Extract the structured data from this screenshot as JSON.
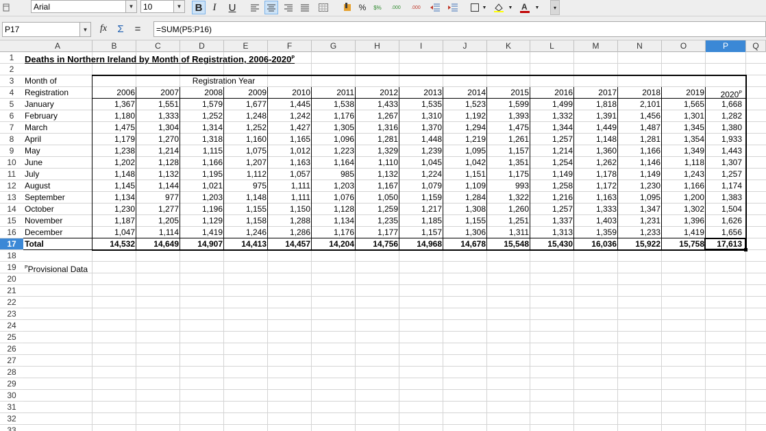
{
  "toolbar": {
    "font_name": "Arial",
    "font_size": "10",
    "bold_label": "B",
    "italic_label": "I",
    "underline_label": "U",
    "percent_label": "%",
    "currency_label": "$%",
    "add_decimal_label": ".000",
    "del_decimal_label": ".000"
  },
  "formula_bar": {
    "cell_ref": "P17",
    "function_wizard_label": "fx",
    "sum_label": "Σ",
    "equals_label": "=",
    "formula": "=SUM(P5:P16)"
  },
  "columns": [
    "A",
    "B",
    "C",
    "D",
    "E",
    "F",
    "G",
    "H",
    "I",
    "J",
    "K",
    "L",
    "M",
    "N",
    "O",
    "P",
    "Q"
  ],
  "selected_column": "P",
  "rows": [
    "1",
    "2",
    "3",
    "4",
    "5",
    "6",
    "7",
    "8",
    "9",
    "10",
    "11",
    "12",
    "13",
    "14",
    "15",
    "16",
    "17",
    "18",
    "19",
    "20",
    "21",
    "22",
    "23",
    "24",
    "25",
    "26",
    "27",
    "28",
    "29",
    "30",
    "31",
    "32",
    "33"
  ],
  "selected_row": "17",
  "sheet": {
    "title": "Deaths in Northern Ireland by Month of Registration, 2006-2020",
    "title_sup": "P",
    "header_month_line1": "Month of",
    "header_month_line2": "Registration",
    "header_year_group": "Registration Year",
    "years": [
      "2006",
      "2007",
      "2008",
      "2009",
      "2010",
      "2011",
      "2012",
      "2013",
      "2014",
      "2015",
      "2016",
      "2017",
      "2018",
      "2019",
      "2020"
    ],
    "last_year_sup": "P",
    "months": [
      {
        "name": "January",
        "values": [
          "1,367",
          "1,551",
          "1,579",
          "1,677",
          "1,445",
          "1,538",
          "1,433",
          "1,535",
          "1,523",
          "1,599",
          "1,499",
          "1,818",
          "2,101",
          "1,565",
          "1,668"
        ]
      },
      {
        "name": "February",
        "values": [
          "1,180",
          "1,333",
          "1,252",
          "1,248",
          "1,242",
          "1,176",
          "1,267",
          "1,310",
          "1,192",
          "1,393",
          "1,332",
          "1,391",
          "1,456",
          "1,301",
          "1,282"
        ]
      },
      {
        "name": "March",
        "values": [
          "1,475",
          "1,304",
          "1,314",
          "1,252",
          "1,427",
          "1,305",
          "1,316",
          "1,370",
          "1,294",
          "1,475",
          "1,344",
          "1,449",
          "1,487",
          "1,345",
          "1,380"
        ]
      },
      {
        "name": "April",
        "values": [
          "1,179",
          "1,270",
          "1,318",
          "1,160",
          "1,165",
          "1,096",
          "1,281",
          "1,448",
          "1,219",
          "1,261",
          "1,257",
          "1,148",
          "1,281",
          "1,354",
          "1,933"
        ]
      },
      {
        "name": "May",
        "values": [
          "1,238",
          "1,214",
          "1,115",
          "1,075",
          "1,012",
          "1,223",
          "1,329",
          "1,239",
          "1,095",
          "1,157",
          "1,214",
          "1,360",
          "1,166",
          "1,349",
          "1,443"
        ]
      },
      {
        "name": "June",
        "values": [
          "1,202",
          "1,128",
          "1,166",
          "1,207",
          "1,163",
          "1,164",
          "1,110",
          "1,045",
          "1,042",
          "1,351",
          "1,254",
          "1,262",
          "1,146",
          "1,118",
          "1,307"
        ]
      },
      {
        "name": "July",
        "values": [
          "1,148",
          "1,132",
          "1,195",
          "1,112",
          "1,057",
          "985",
          "1,132",
          "1,224",
          "1,151",
          "1,175",
          "1,149",
          "1,178",
          "1,149",
          "1,243",
          "1,257"
        ]
      },
      {
        "name": "August",
        "values": [
          "1,145",
          "1,144",
          "1,021",
          "975",
          "1,111",
          "1,203",
          "1,167",
          "1,079",
          "1,109",
          "993",
          "1,258",
          "1,172",
          "1,230",
          "1,166",
          "1,174"
        ]
      },
      {
        "name": "September",
        "values": [
          "1,134",
          "977",
          "1,203",
          "1,148",
          "1,111",
          "1,076",
          "1,050",
          "1,159",
          "1,284",
          "1,322",
          "1,216",
          "1,163",
          "1,095",
          "1,200",
          "1,383"
        ]
      },
      {
        "name": "October",
        "values": [
          "1,230",
          "1,277",
          "1,196",
          "1,155",
          "1,150",
          "1,128",
          "1,259",
          "1,217",
          "1,308",
          "1,260",
          "1,257",
          "1,333",
          "1,347",
          "1,302",
          "1,504"
        ]
      },
      {
        "name": "November",
        "values": [
          "1,187",
          "1,205",
          "1,129",
          "1,158",
          "1,288",
          "1,134",
          "1,235",
          "1,185",
          "1,155",
          "1,251",
          "1,337",
          "1,403",
          "1,231",
          "1,396",
          "1,626"
        ]
      },
      {
        "name": "December",
        "values": [
          "1,047",
          "1,114",
          "1,419",
          "1,246",
          "1,286",
          "1,176",
          "1,177",
          "1,157",
          "1,306",
          "1,311",
          "1,313",
          "1,359",
          "1,233",
          "1,419",
          "1,656"
        ]
      }
    ],
    "total_label": "Total",
    "totals": [
      "14,532",
      "14,649",
      "14,907",
      "14,413",
      "14,457",
      "14,204",
      "14,756",
      "14,968",
      "14,678",
      "15,548",
      "15,430",
      "16,036",
      "15,922",
      "15,758",
      "17,613"
    ],
    "footnote_sup": "P",
    "footnote": "Provisional Data"
  }
}
